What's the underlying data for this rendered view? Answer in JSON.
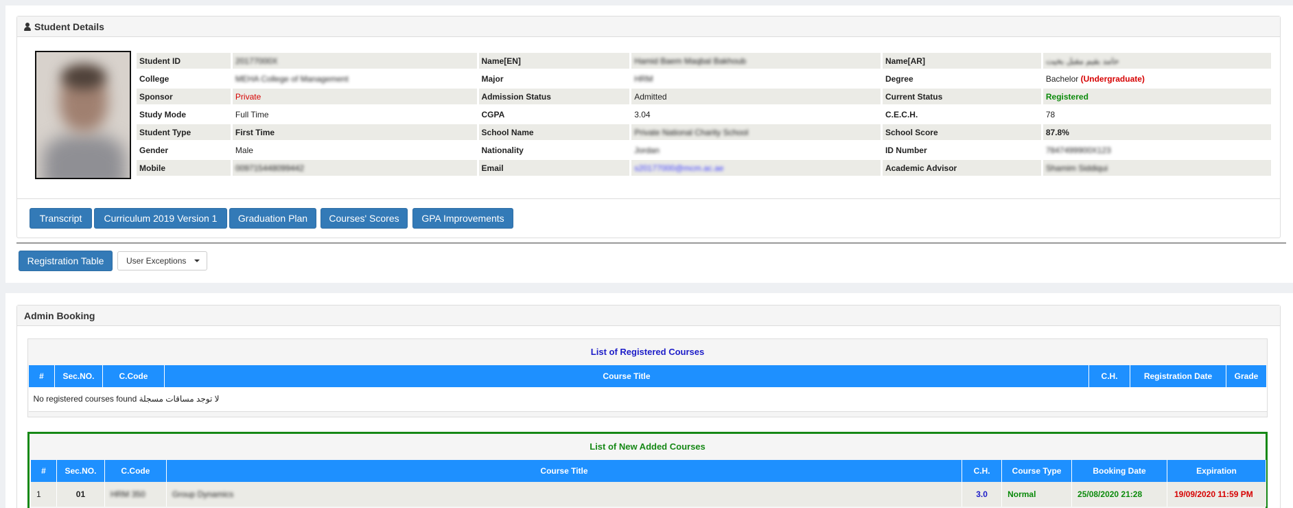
{
  "student": {
    "heading": "Student Details",
    "rows": [
      [
        {
          "l": "Student ID",
          "v": "20177000X",
          "b": true
        },
        {
          "l": "Name[EN]",
          "v": "Hamid Baem Maqbal Bakhoub",
          "b": true
        },
        {
          "l": "Name[AR]",
          "v": "حامد بقيم مقبل بخيت",
          "b": true
        }
      ],
      [
        {
          "l": "College",
          "v": "MEHA College of Management",
          "b": true
        },
        {
          "l": "Major",
          "v": "HRM",
          "b": true
        },
        {
          "l": "Degree",
          "v": "Bachelor",
          "extra": "(Undergraduate)"
        }
      ],
      [
        {
          "l": "Sponsor",
          "v": "Private",
          "c": "red"
        },
        {
          "l": "Admission Status",
          "v": "Admitted"
        },
        {
          "l": "Current Status",
          "v": "Registered",
          "c": "green"
        }
      ],
      [
        {
          "l": "Study Mode",
          "v": "Full Time"
        },
        {
          "l": "CGPA",
          "v": "3.04"
        },
        {
          "l": "C.E.C.H.",
          "v": "78"
        }
      ],
      [
        {
          "l": "Student Type",
          "v": "First Time",
          "c": "bold"
        },
        {
          "l": "School Name",
          "v": "Private National Charity School",
          "b": true
        },
        {
          "l": "School Score",
          "v": "87.8%",
          "c": "bold"
        }
      ],
      [
        {
          "l": "Gender",
          "v": "Male"
        },
        {
          "l": "Nationality",
          "v": "Jordan",
          "b": true
        },
        {
          "l": "ID Number",
          "v": "7847499900X123",
          "b": true
        }
      ],
      [
        {
          "l": "Mobile",
          "v": "009715448099442",
          "b": true
        },
        {
          "l": "Email",
          "v": "s20177000@mcm.ac.ae",
          "b": true,
          "c": "link"
        },
        {
          "l": "Academic Advisor",
          "v": "Shamim Siddiqui",
          "b": true
        }
      ]
    ]
  },
  "actions": {
    "transcript": "Transcript",
    "curriculum": "Curriculum 2019 Version 1",
    "graduation_plan": "Graduation Plan",
    "courses_scores": "Courses' Scores",
    "gpa_improvements": "GPA Improvements",
    "registration_table": "Registration Table",
    "user_exceptions": "User Exceptions"
  },
  "admin": {
    "heading": "Admin Booking",
    "registered": {
      "title": "List of Registered Courses",
      "columns": [
        "#",
        "Sec.NO.",
        "C.Code",
        "Course Title",
        "C.H.",
        "Registration Date",
        "Grade"
      ],
      "empty": "No registered courses found لا توجد مساقات مسجلة"
    },
    "added": {
      "title": "List of New Added Courses",
      "columns": [
        "#",
        "Sec.NO.",
        "C.Code",
        "Course Title",
        "C.H.",
        "Course Type",
        "Booking Date",
        "Expiration"
      ],
      "rows": [
        {
          "n": "1",
          "sec": "01",
          "code": "HRM 350",
          "title": "Group Dynamics",
          "ch": "3.0",
          "type": "Normal",
          "booking": "25/08/2020 21:28",
          "exp": "19/09/2020 11:59 PM"
        }
      ]
    }
  },
  "colors": {
    "primary": "#337ab7",
    "header_blue": "#1e90ff",
    "red": "#d60000",
    "green": "#0a8a0a",
    "reg_title": "#1c1cc8",
    "added_title": "#168816"
  }
}
